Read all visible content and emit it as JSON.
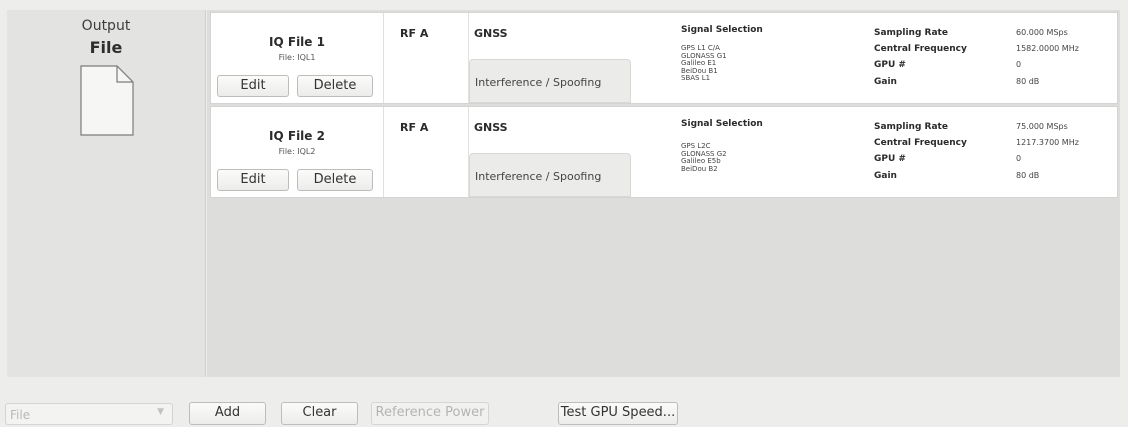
{
  "left_panel": {
    "label": "Output",
    "title": "File",
    "icon": "document-icon"
  },
  "rows": [
    {
      "name": "IQ File 1",
      "file": "File: IQL1",
      "edit": "Edit",
      "delete": "Delete",
      "rf": "RF A",
      "tab_gnss": "GNSS",
      "tab_interference": "Interference / Spoofing",
      "signal_header": "Signal Selection",
      "signals": [
        "GPS L1 C/A",
        "GLONASS G1",
        "Galileo E1",
        "BeiDou B1",
        "SBAS L1"
      ],
      "params": [
        {
          "label": "Sampling Rate",
          "value": "60.000 MSps"
        },
        {
          "label": "Central Frequency",
          "value": "1582.0000 MHz"
        },
        {
          "label": "GPU #",
          "value": "0"
        },
        {
          "label": "Gain",
          "value": "80 dB"
        }
      ]
    },
    {
      "name": "IQ File 2",
      "file": "File: IQL2",
      "edit": "Edit",
      "delete": "Delete",
      "rf": "RF A",
      "tab_gnss": "GNSS",
      "tab_interference": "Interference / Spoofing",
      "signal_header": "Signal Selection",
      "signals": [
        "GPS L2C",
        "GLONASS G2",
        "Galileo E5b",
        "BeiDou B2"
      ],
      "params": [
        {
          "label": "Sampling Rate",
          "value": "75.000 MSps"
        },
        {
          "label": "Central Frequency",
          "value": "1217.3700 MHz"
        },
        {
          "label": "GPU #",
          "value": "0"
        },
        {
          "label": "Gain",
          "value": "80 dB"
        }
      ]
    }
  ],
  "bottom_bar": {
    "file_select": "File",
    "add": "Add",
    "clear": "Clear",
    "reference_power": "Reference Power",
    "test_gpu": "Test GPU Speed..."
  }
}
